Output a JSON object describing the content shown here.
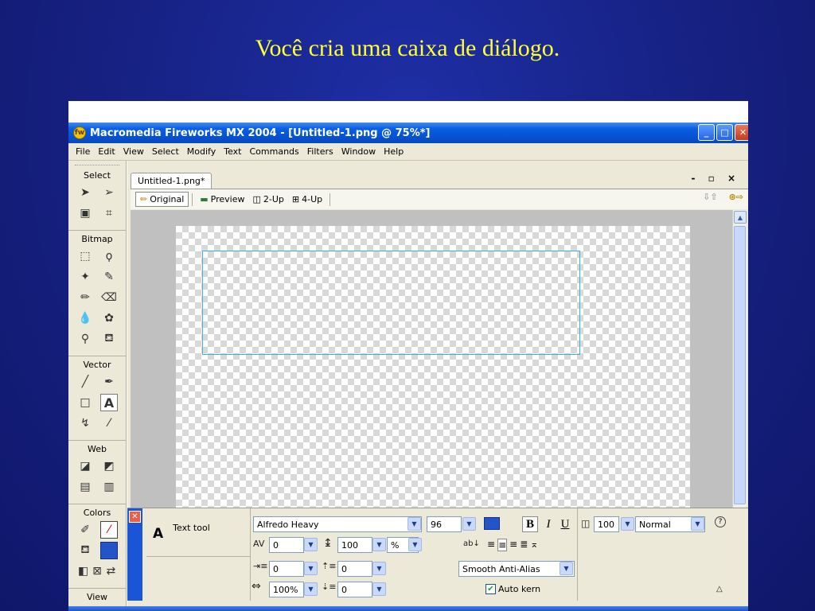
{
  "slide": {
    "title": "Você cria uma caixa de diálogo."
  },
  "window": {
    "title": "Macromedia Fireworks MX 2004 - [Untitled-1.png @  75%*]",
    "buttons": {
      "minimize": "_",
      "maximize": "□",
      "close": "✕"
    }
  },
  "menu": [
    "File",
    "Edit",
    "View",
    "Select",
    "Modify",
    "Text",
    "Commands",
    "Filters",
    "Window",
    "Help"
  ],
  "toolbox": {
    "sections": {
      "select": "Select",
      "bitmap": "Bitmap",
      "vector": "Vector",
      "web": "Web",
      "colors": "Colors",
      "view": "View"
    },
    "text_tool_glyph": "A"
  },
  "document": {
    "tab": "Untitled-1.png*",
    "controls": "- ▫ ×",
    "views": {
      "original": "Original",
      "preview": "Preview",
      "two_up": "2-Up",
      "four_up": "4-Up"
    }
  },
  "properties": {
    "tool_label": "Text tool",
    "tool_glyph": "A",
    "font": "Alfredo Heavy",
    "size": "96",
    "kerning": "0",
    "leading": "100",
    "leading_unit": "%",
    "scale": "100",
    "blend_mode": "Normal",
    "indent": "0",
    "space_before": "0",
    "horizontal_scale": "100%",
    "space_after": "0",
    "baseline_shift": "0",
    "anti_alias": "Smooth Anti-Alias",
    "auto_kern": "Auto kern",
    "auto_kern_checked": true,
    "bold": "B",
    "italic": "I",
    "underline": "U",
    "fill_color": "#2354c8"
  },
  "colors": {
    "titlebar": "#0451d4",
    "chrome": "#ece9d8",
    "selection_box": "#3ab0e6",
    "slide_title": "#ffff33"
  }
}
